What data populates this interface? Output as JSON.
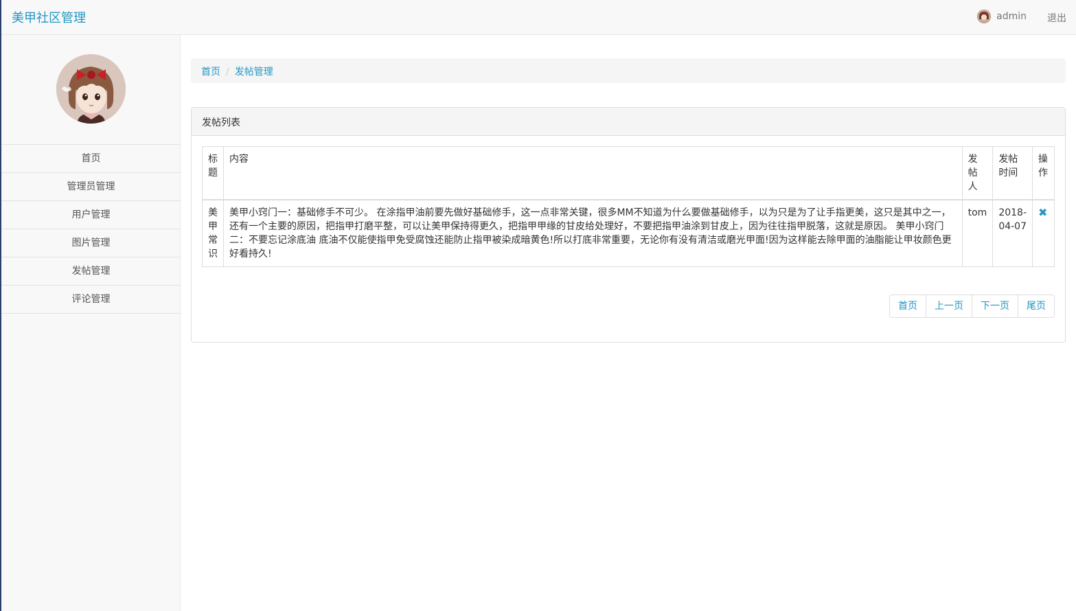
{
  "navbar": {
    "brand": "美甲社区管理",
    "username": "admin",
    "logout": "退出"
  },
  "sidebar": {
    "items": [
      {
        "label": "首页"
      },
      {
        "label": "管理员管理"
      },
      {
        "label": "用户管理"
      },
      {
        "label": "图片管理"
      },
      {
        "label": "发帖管理"
      },
      {
        "label": "评论管理"
      }
    ]
  },
  "breadcrumb": {
    "home": "首页",
    "current": "发帖管理",
    "separator": "/"
  },
  "panel": {
    "title": "发帖列表"
  },
  "table": {
    "headers": {
      "title": "标题",
      "content": "内容",
      "author": "发帖人",
      "time": "发帖时间",
      "action": "操作"
    },
    "rows": [
      {
        "title": "美甲常识",
        "content": "美甲小窍门一：基础修手不可少。 在涂指甲油前要先做好基础修手，这一点非常关键，很多MM不知道为什么要做基础修手，以为只是为了让手指更美，这只是其中之一，还有一个主要的原因，把指甲打磨平整，可以让美甲保持得更久，把指甲甲缘的甘皮给处理好，不要把指甲油涂到甘皮上，因为往往指甲脱落，这就是原因。 美甲小窍门二：不要忘记涂底油 底油不仅能使指甲免受腐蚀还能防止指甲被染成暗黄色!所以打底非常重要，无论你有没有清洁或磨光甲面!因为这样能去除甲面的油脂能让甲妆颜色更好看持久!",
        "author": "tom",
        "time": "2018-04-07",
        "action_icon": "✖"
      }
    ]
  },
  "pager": {
    "first": "首页",
    "prev": "上一页",
    "next": "下一页",
    "last": "尾页"
  },
  "colors": {
    "accent": "#2196c4",
    "navbar_bg": "#f8f8f8",
    "border": "#dddddd"
  }
}
